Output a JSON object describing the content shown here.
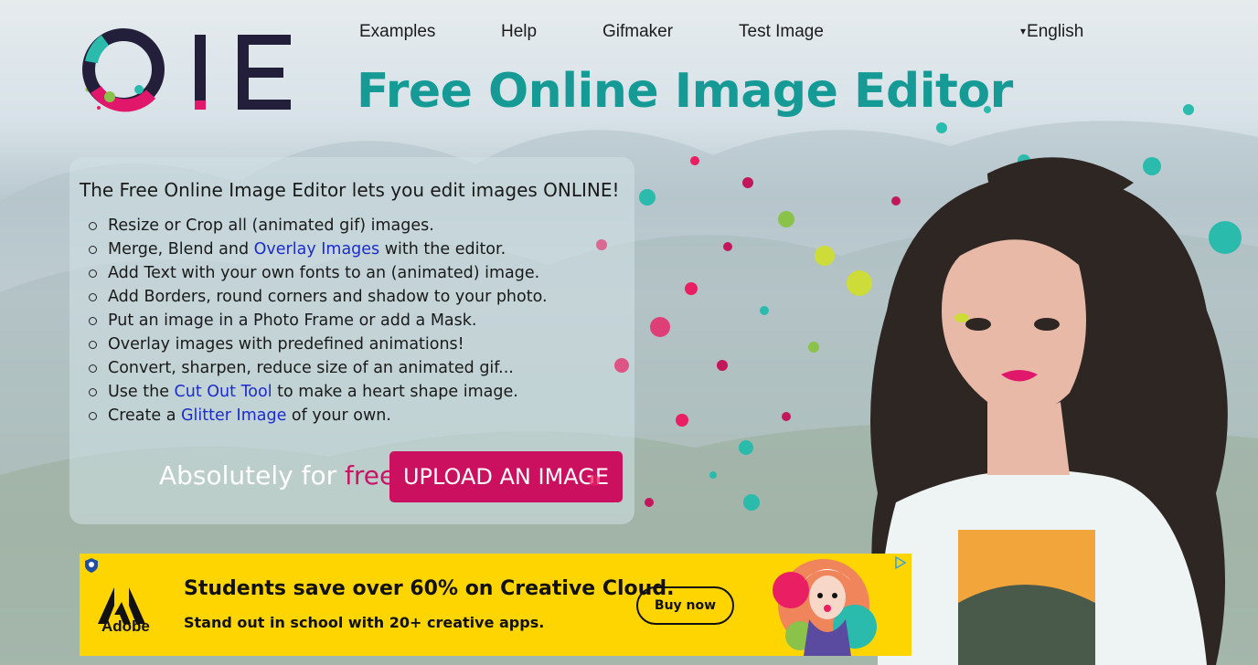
{
  "logo": {
    "text": "OIE"
  },
  "nav": {
    "items": [
      {
        "label": "Examples"
      },
      {
        "label": "Help"
      },
      {
        "label": "Gifmaker"
      },
      {
        "label": "Test Image"
      }
    ],
    "language": "English"
  },
  "title": "Free Online Image Editor",
  "intro": "The Free Online Image Editor lets you edit images ONLINE!",
  "features": [
    {
      "before": "Resize or Crop all (animated gif) images.",
      "link": "",
      "after": ""
    },
    {
      "before": "Merge, Blend and ",
      "link": "Overlay Images",
      "after": " with the editor."
    },
    {
      "before": "Add Text with your own fonts to an (animated) image.",
      "link": "",
      "after": ""
    },
    {
      "before": "Add Borders, round corners and shadow to your photo.",
      "link": "",
      "after": ""
    },
    {
      "before": "Put an image in a Photo Frame or add a Mask.",
      "link": "",
      "after": ""
    },
    {
      "before": "Overlay images with predefined animations!",
      "link": "",
      "after": ""
    },
    {
      "before": "Convert, sharpen, reduce size of an animated gif...",
      "link": "",
      "after": ""
    },
    {
      "before": "Use the ",
      "link": "Cut Out Tool",
      "after": " to make a heart shape image."
    },
    {
      "before": "Create a ",
      "link": "Glitter Image",
      "after": " of your own."
    }
  ],
  "tagline": {
    "prefix": "Absolutely for ",
    "highlight": "free"
  },
  "upload_button": "UPLOAD AN IMAGE",
  "ad": {
    "brand": "Adobe",
    "headline": "Students save over 60% on Creative Cloud.",
    "subline": "Stand out in school with 20+ creative apps.",
    "cta": "Buy now",
    "background": "#ffd500"
  },
  "colors": {
    "title": "#169a95",
    "link": "#1b2ccc",
    "accent": "#cc1060",
    "logo_dark": "#231f3a"
  },
  "icons": {
    "language_caret": "caret-down-icon",
    "ad_choices": "ad-choices-icon",
    "ad_shield": "shield-icon"
  }
}
